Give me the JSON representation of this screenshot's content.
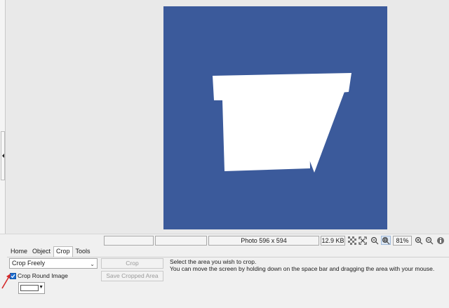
{
  "image": {
    "logo_text": "TV",
    "background_color": "#3b5a9b",
    "logo_color": "#ffffff"
  },
  "status_bar": {
    "photo_info": "Photo 596 x 594",
    "file_size": "12.9 KB",
    "zoom_level": "81%"
  },
  "tabs": [
    {
      "label": "Home"
    },
    {
      "label": "Object"
    },
    {
      "label": "Crop"
    },
    {
      "label": "Tools"
    }
  ],
  "active_tab": "Crop",
  "crop_panel": {
    "mode_value": "Crop Freely",
    "crop_button": "Crop",
    "save_cropped_button": "Save Cropped Area",
    "instructions_line1": "Select the area you wish to crop.",
    "instructions_line2": "You can move the screen by holding down on the space bar and dragging the area with your mouse.",
    "crop_round_label": "Crop Round Image",
    "crop_round_checked": true
  },
  "colors": {
    "accent": "#1e6fd1",
    "annotation_arrow": "#d42a2a"
  }
}
